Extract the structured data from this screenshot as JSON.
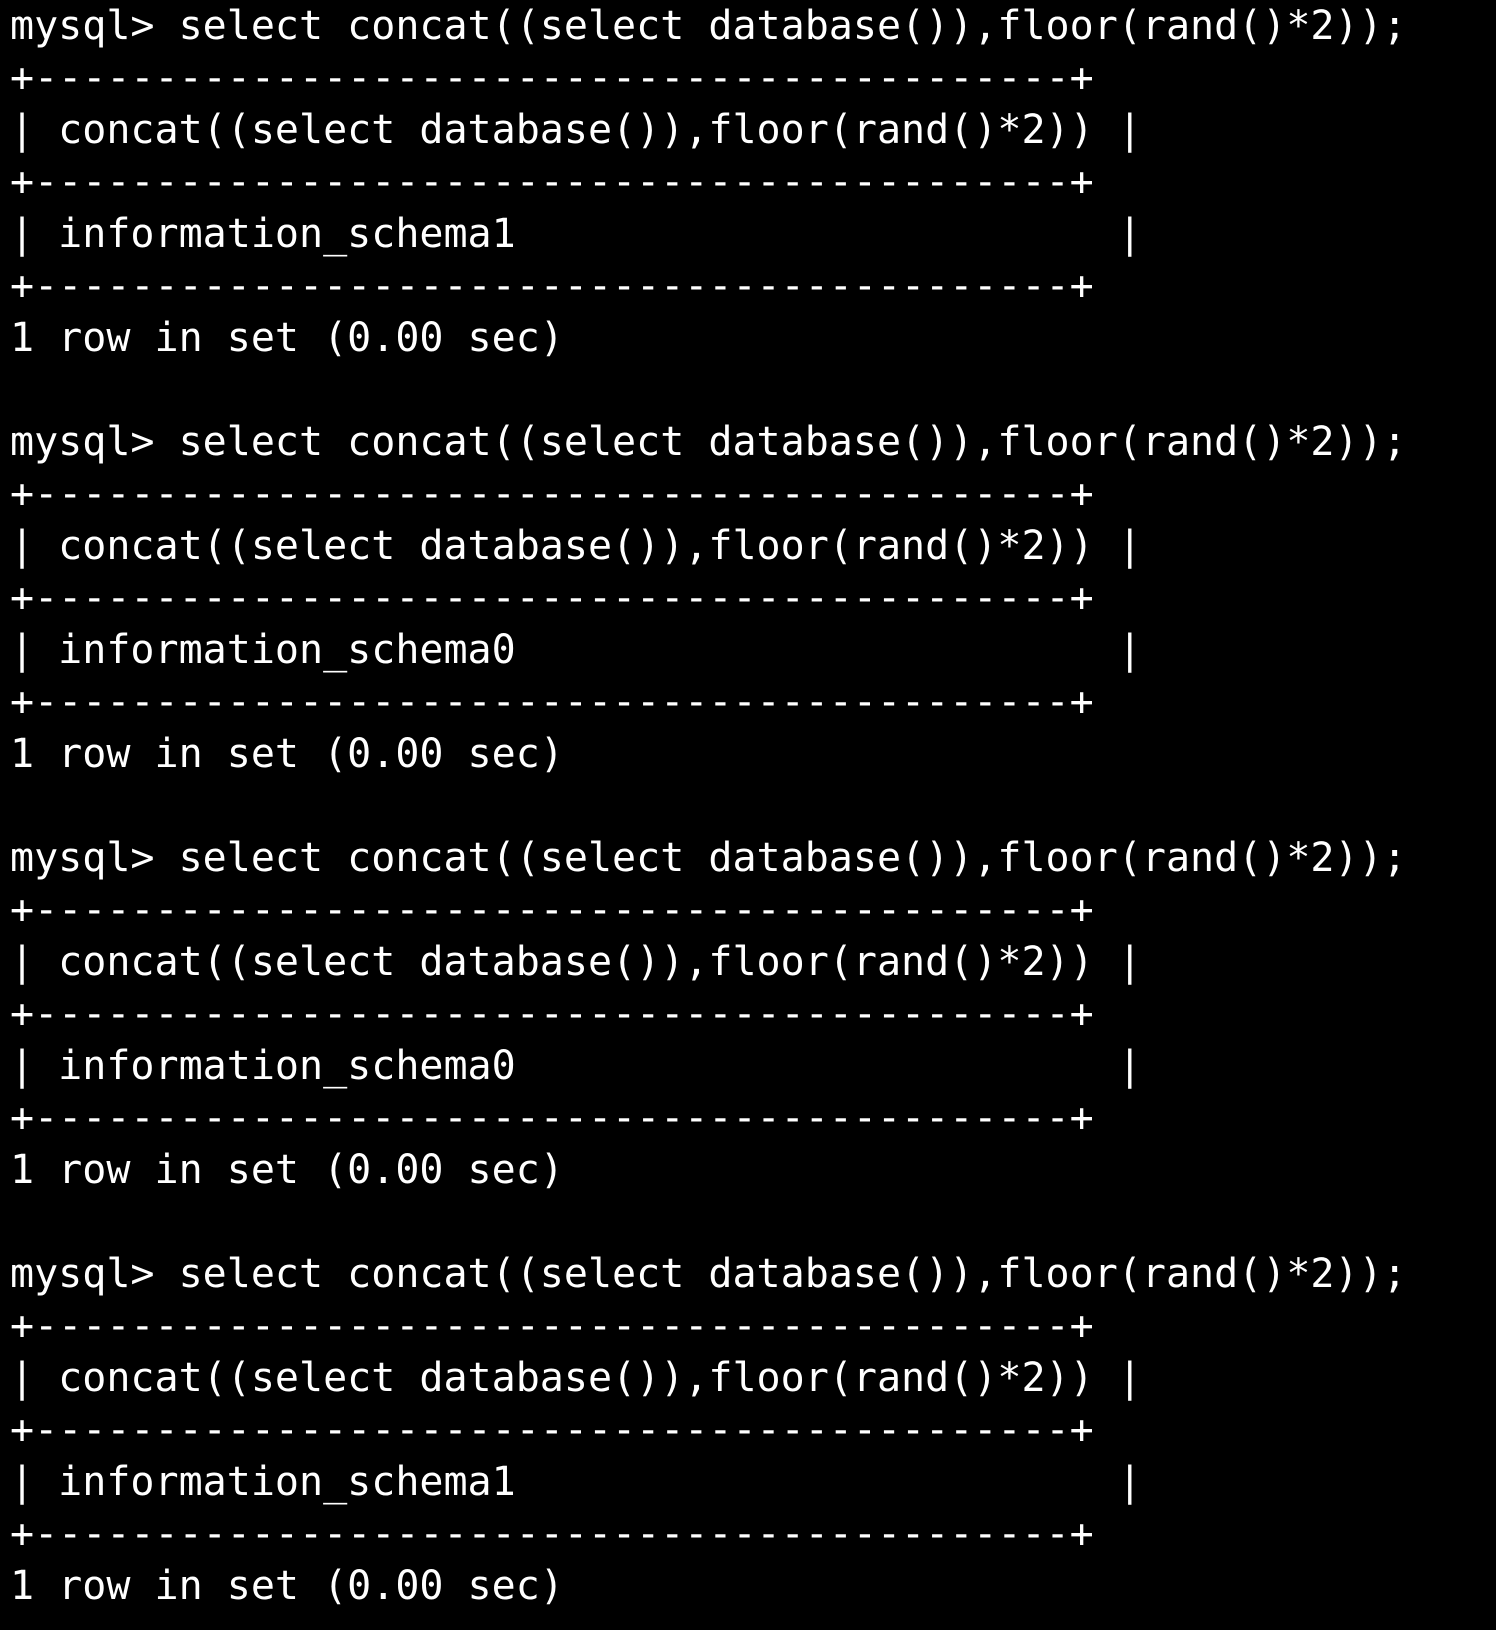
{
  "terminal": {
    "background": "#000000",
    "foreground": "#ffffff",
    "blocks": [
      {
        "prompt": "mysql> select concat((select database()),floor(rand()*2));",
        "border_top": "+-------------------------------------------+",
        "header_row": "| concat((select database()),floor(rand()*2)) |",
        "border_mid": "+-------------------------------------------+",
        "value_row": "| information_schema1                         |",
        "border_bottom": "+-------------------------------------------+",
        "summary": "1 row in set (0.00 sec)"
      },
      {
        "prompt": "mysql> select concat((select database()),floor(rand()*2));",
        "border_top": "+-------------------------------------------+",
        "header_row": "| concat((select database()),floor(rand()*2)) |",
        "border_mid": "+-------------------------------------------+",
        "value_row": "| information_schema0                         |",
        "border_bottom": "+-------------------------------------------+",
        "summary": "1 row in set (0.00 sec)"
      },
      {
        "prompt": "mysql> select concat((select database()),floor(rand()*2));",
        "border_top": "+-------------------------------------------+",
        "header_row": "| concat((select database()),floor(rand()*2)) |",
        "border_mid": "+-------------------------------------------+",
        "value_row": "| information_schema0                         |",
        "border_bottom": "+-------------------------------------------+",
        "summary": "1 row in set (0.00 sec)"
      },
      {
        "prompt": "mysql> select concat((select database()),floor(rand()*2));",
        "border_top": "+-------------------------------------------+",
        "header_row": "| concat((select database()),floor(rand()*2)) |",
        "border_mid": "+-------------------------------------------+",
        "value_row": "| information_schema1                         |",
        "border_bottom": "+-------------------------------------------+",
        "summary": "1 row in set (0.00 sec)"
      }
    ]
  }
}
